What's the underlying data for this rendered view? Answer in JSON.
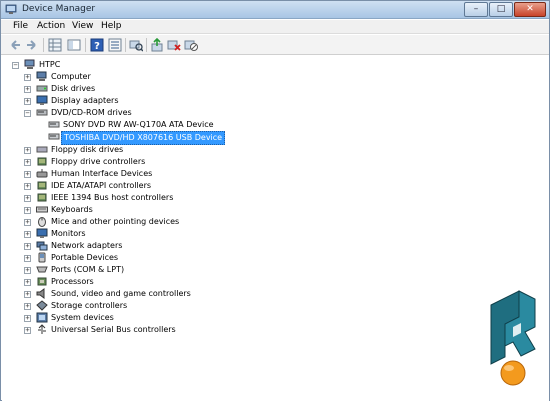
{
  "window": {
    "title": "Device Manager",
    "btn_min": "–",
    "btn_max": "□",
    "btn_close": "✕"
  },
  "menu": {
    "file": "File",
    "action": "Action",
    "view": "View",
    "help": "Help"
  },
  "tree": {
    "root": "HTPC",
    "categories": [
      {
        "label": "Computer",
        "expander": "+"
      },
      {
        "label": "Disk drives",
        "expander": "+"
      },
      {
        "label": "Display adapters",
        "expander": "+"
      },
      {
        "label": "DVD/CD-ROM drives",
        "expander": "−"
      },
      {
        "label": "Floppy disk drives",
        "expander": "+"
      },
      {
        "label": "Floppy drive controllers",
        "expander": "+"
      },
      {
        "label": "Human Interface Devices",
        "expander": "+"
      },
      {
        "label": "IDE ATA/ATAPI controllers",
        "expander": "+"
      },
      {
        "label": "IEEE 1394 Bus host controllers",
        "expander": "+"
      },
      {
        "label": "Keyboards",
        "expander": "+"
      },
      {
        "label": "Mice and other pointing devices",
        "expander": "+"
      },
      {
        "label": "Monitors",
        "expander": "+"
      },
      {
        "label": "Network adapters",
        "expander": "+"
      },
      {
        "label": "Portable Devices",
        "expander": "+"
      },
      {
        "label": "Ports (COM & LPT)",
        "expander": "+"
      },
      {
        "label": "Processors",
        "expander": "+"
      },
      {
        "label": "Sound, video and game controllers",
        "expander": "+"
      },
      {
        "label": "Storage controllers",
        "expander": "+"
      },
      {
        "label": "System devices",
        "expander": "+"
      },
      {
        "label": "Universal Serial Bus controllers",
        "expander": "+"
      }
    ],
    "dvd_children": [
      {
        "label": "SONY DVD RW AW-Q170A ATA Device",
        "selected": false
      },
      {
        "label": "TOSHIBA DVD/HD  X807616 USB Device",
        "selected": true
      }
    ]
  },
  "colors": {
    "selection": "#3399ff",
    "logo_orange": "#f39a1e",
    "logo_teal": "#1f7a8c"
  }
}
